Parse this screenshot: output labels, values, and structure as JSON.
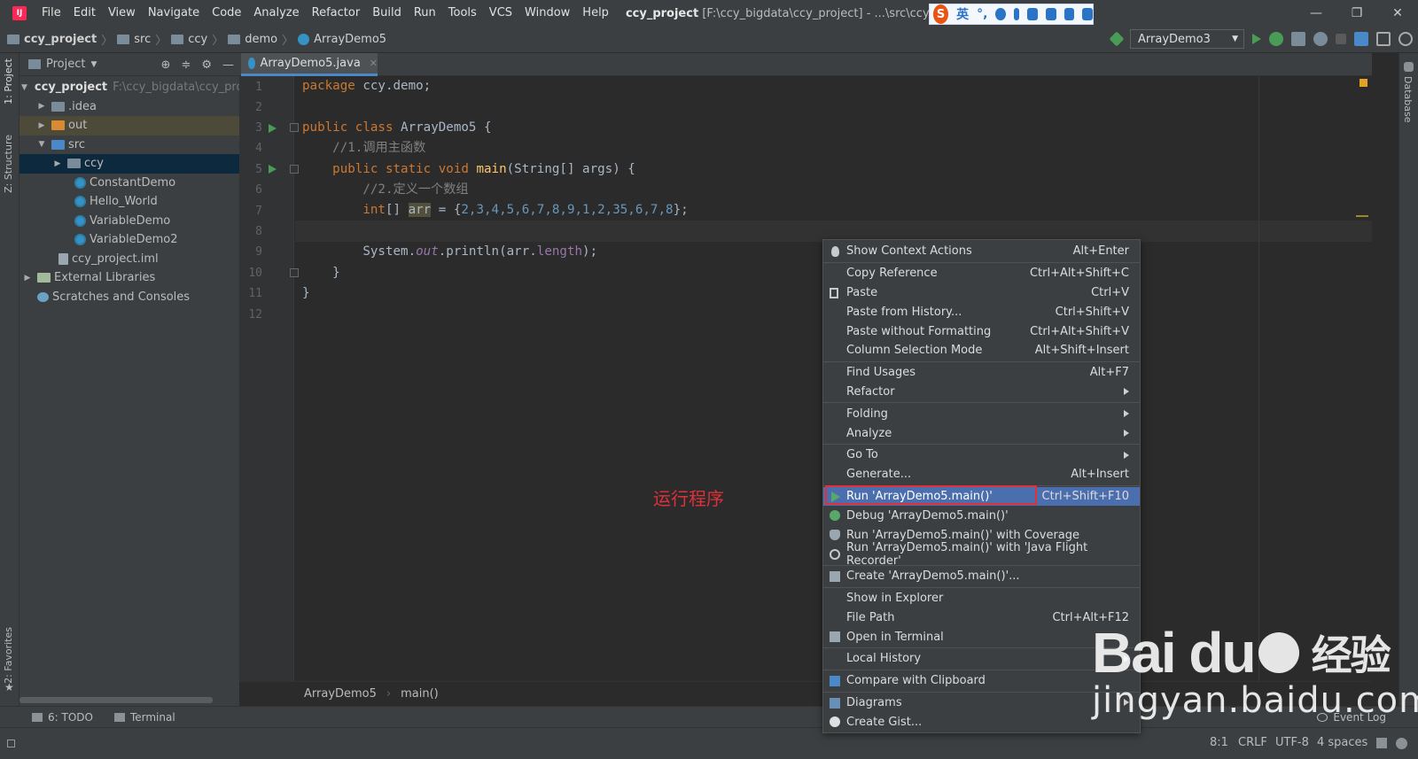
{
  "menubar": {
    "items": [
      "File",
      "Edit",
      "View",
      "Navigate",
      "Code",
      "Analyze",
      "Refactor",
      "Build",
      "Run",
      "Tools",
      "VCS",
      "Window",
      "Help"
    ],
    "title_project": "ccy_project",
    "title_path": "[F:\\ccy_bigdata\\ccy_project] - ...\\src\\ccy\\demo\\Arr"
  },
  "ime": {
    "logo": "S",
    "lang": "英"
  },
  "navbar": {
    "crumbs": [
      "ccy_project",
      "src",
      "ccy",
      "demo",
      "ArrayDemo5"
    ],
    "run_config": "ArrayDemo3"
  },
  "side_tabs": {
    "project": "1: Project",
    "structure": "Z: Structure",
    "favorites": "2: Favorites",
    "database": "Database"
  },
  "project": {
    "header": "Project",
    "root": "ccy_project",
    "root_path": "F:\\ccy_bigdata\\ccy_pro",
    "items": [
      ".idea",
      "out",
      "src",
      "ccy",
      "ConstantDemo",
      "Hello_World",
      "VariableDemo",
      "VariableDemo2",
      "ccy_project.iml",
      "External Libraries",
      "Scratches and Consoles"
    ]
  },
  "editor": {
    "tab": "ArrayDemo5.java",
    "line_numbers": [
      "1",
      "2",
      "3",
      "4",
      "5",
      "6",
      "7",
      "8",
      "9",
      "10",
      "11",
      "12"
    ],
    "code": {
      "l1_kw": "package",
      "l1_rest": " ccy.demo;",
      "l3_kw": "public class",
      "l3_rest": " ArrayDemo5 {",
      "l4": "    //1.调用主函数",
      "l5_kw": "    public static void",
      "l5_fn": " main",
      "l5_rest": "(String[] args) {",
      "l6": "        //2.定义一个数组",
      "l7_kw": "        int",
      "l7_a": "[] ",
      "l7_var": "arr",
      "l7_b": " = {",
      "l7_nums": "2,3,4,5,6,7,8,9,1,2,35,6,7,8",
      "l7_c": "};",
      "l9_a": "        System.",
      "l9_out": "out",
      "l9_b": ".println(arr.",
      "l9_len": "length",
      "l9_c": ");",
      "l10": "    }",
      "l11": "}"
    },
    "breadcrumb": [
      "ArrayDemo5",
      "main()"
    ]
  },
  "context_menu": {
    "items": [
      {
        "label": "Show Context Actions",
        "shortcut": "Alt+Enter"
      },
      {
        "label": "Copy Reference",
        "shortcut": "Ctrl+Alt+Shift+C"
      },
      {
        "label": "Paste",
        "shortcut": "Ctrl+V"
      },
      {
        "label": "Paste from History...",
        "shortcut": "Ctrl+Shift+V"
      },
      {
        "label": "Paste without Formatting",
        "shortcut": "Ctrl+Alt+Shift+V"
      },
      {
        "label": "Column Selection Mode",
        "shortcut": "Alt+Shift+Insert"
      },
      {
        "label": "Find Usages",
        "shortcut": "Alt+F7"
      },
      {
        "label": "Refactor",
        "shortcut": ""
      },
      {
        "label": "Folding",
        "shortcut": ""
      },
      {
        "label": "Analyze",
        "shortcut": ""
      },
      {
        "label": "Go To",
        "shortcut": ""
      },
      {
        "label": "Generate...",
        "shortcut": "Alt+Insert"
      },
      {
        "label": "Run 'ArrayDemo5.main()'",
        "shortcut": "Ctrl+Shift+F10"
      },
      {
        "label": "Debug 'ArrayDemo5.main()'",
        "shortcut": ""
      },
      {
        "label": "Run 'ArrayDemo5.main()' with Coverage",
        "shortcut": ""
      },
      {
        "label": "Run 'ArrayDemo5.main()' with 'Java Flight Recorder'",
        "shortcut": ""
      },
      {
        "label": "Create 'ArrayDemo5.main()'...",
        "shortcut": ""
      },
      {
        "label": "Show in Explorer",
        "shortcut": ""
      },
      {
        "label": "File Path",
        "shortcut": "Ctrl+Alt+F12"
      },
      {
        "label": "Open in Terminal",
        "shortcut": ""
      },
      {
        "label": "Local History",
        "shortcut": ""
      },
      {
        "label": "Compare with Clipboard",
        "shortcut": ""
      },
      {
        "label": "Diagrams",
        "shortcut": ""
      },
      {
        "label": "Create Gist...",
        "shortcut": ""
      }
    ]
  },
  "annotation": "运行程序",
  "toolwindows": {
    "todo": "6: TODO",
    "terminal": "Terminal",
    "event_log": "Event Log"
  },
  "status": {
    "position": "8:1",
    "line_sep": "CRLF",
    "encoding": "UTF-8",
    "indent": "4 spaces"
  },
  "watermark": {
    "brand": "Bai du",
    "cn": "经验",
    "url": "jingyan.baidu.com"
  },
  "colors": {
    "accent": "#4b6eaf",
    "run_green": "#499c54",
    "annotation_red": "#e0303a"
  }
}
